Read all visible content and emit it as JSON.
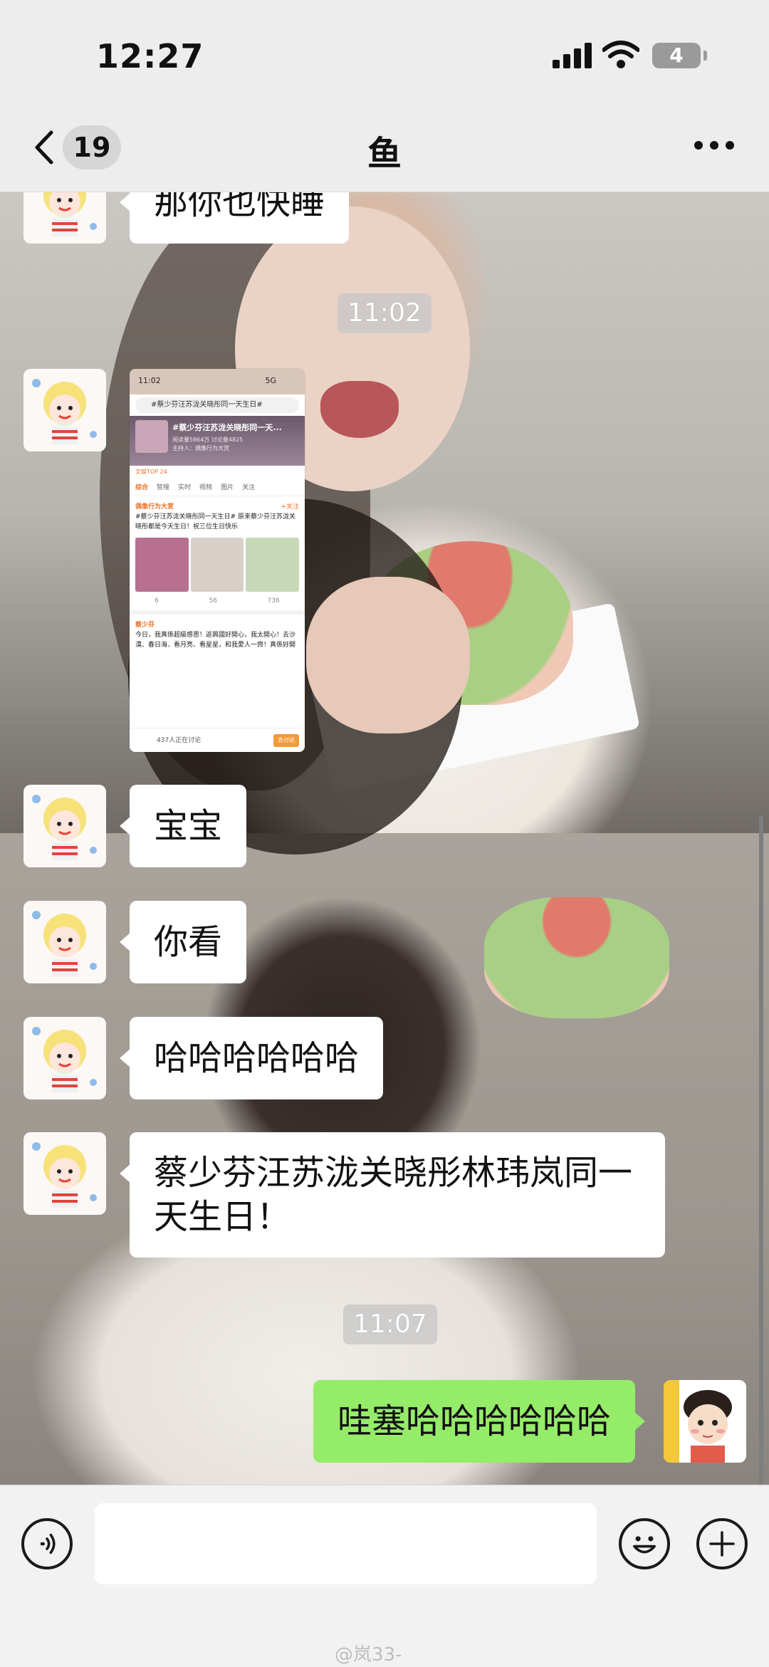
{
  "status_bar": {
    "time": "12:27",
    "battery": "4"
  },
  "nav": {
    "unread_count": "19",
    "title": "鱼"
  },
  "messages": [
    {
      "side": "left",
      "text": "那你也快睡"
    },
    {
      "side": "time",
      "text": "11:02"
    },
    {
      "side": "left",
      "type": "image"
    },
    {
      "side": "left",
      "text": "宝宝"
    },
    {
      "side": "left",
      "text": "你看"
    },
    {
      "side": "left",
      "text": "哈哈哈哈哈哈"
    },
    {
      "side": "left",
      "text": "蔡少芬汪苏泷关晓彤林玮岚同一天生日！"
    },
    {
      "side": "time",
      "text": "11:07"
    },
    {
      "side": "right",
      "text": "哇塞哈哈哈哈哈哈"
    }
  ],
  "shared_screenshot": {
    "time": "11:02",
    "signal": "5G",
    "search": "#蔡少芬汪苏泷关晓彤同一天生日#",
    "topic_title": "#蔡少芬汪苏泷关晓彤同一天...",
    "topic_stats": "阅读量5864万 讨论量4825",
    "topic_host": "主持人：偶像行为大赏",
    "rank": "文娱TOP 24",
    "tabs": [
      "综合",
      "智搜",
      "实时",
      "视频",
      "图片",
      "关注"
    ],
    "post1_author": "偶像行为大赏",
    "post1_follow": "+关注",
    "post1_text": "#蔡少芬汪苏泷关晓彤同一天生日# 原来蔡少芬汪苏泷关晓彤都是今天生日！祝三位生日快乐",
    "post1_actions": [
      "6",
      "56",
      "736"
    ],
    "post2_author": "蔡少芬",
    "post2_text": "今日，我真係超級感恩！返興國好開心，我太開心！去沙漠、春日海、看月亮、看星星，和我愛人一齊！真係好開心",
    "viewers": "437人正在讨论",
    "join": "去讨论"
  },
  "watermark": "@岚33-",
  "icon_names": [
    "chevron-left-icon",
    "more-icon",
    "voice-icon",
    "emoji-icon",
    "plus-icon",
    "signal-icon",
    "wifi-icon",
    "battery-icon"
  ]
}
